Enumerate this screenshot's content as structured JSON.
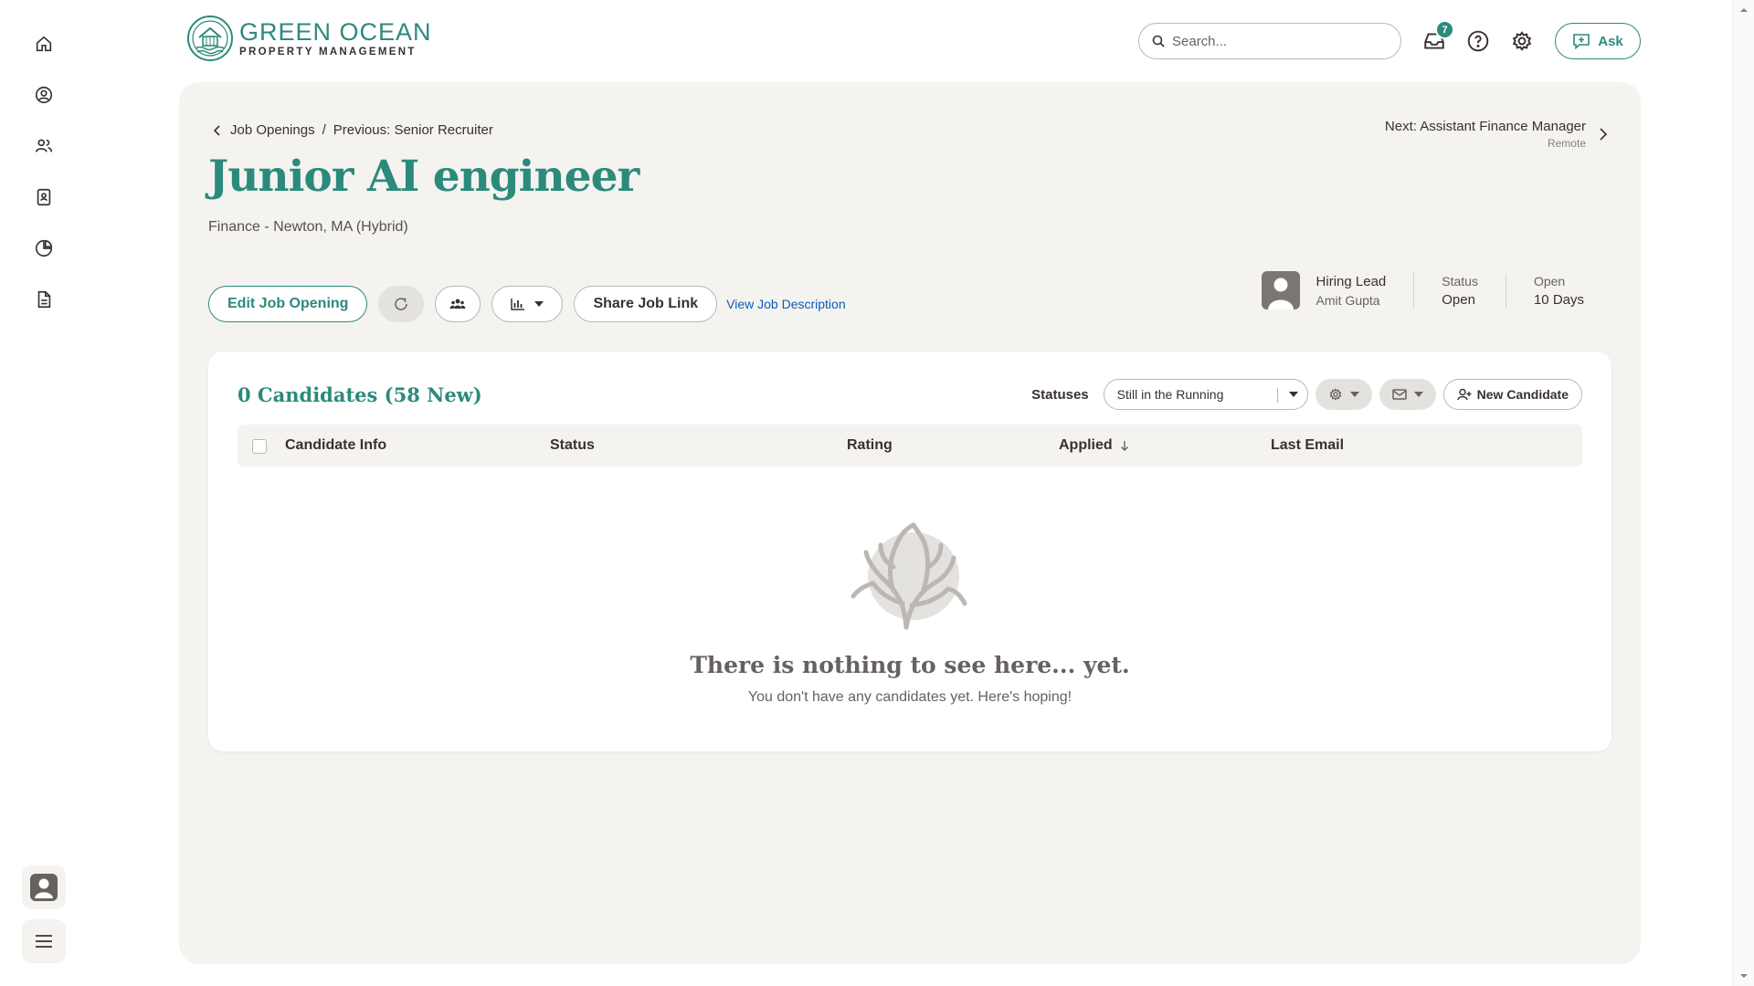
{
  "brand": {
    "line1": "GREEN OCEAN",
    "line2": "PROPERTY MANAGEMENT",
    "accent": "#2c8a7c"
  },
  "sidebar": {
    "items": [
      {
        "name": "home-icon"
      },
      {
        "name": "profile-icon"
      },
      {
        "name": "people-icon"
      },
      {
        "name": "directory-icon"
      },
      {
        "name": "reports-icon"
      },
      {
        "name": "documents-icon"
      }
    ]
  },
  "header": {
    "search_placeholder": "Search...",
    "inbox_count": "7",
    "ask_label": "Ask"
  },
  "breadcrumb": {
    "parent": "Job Openings",
    "separator": "/",
    "previous": "Previous: Senior Recruiter",
    "next_title": "Next: Assistant Finance Manager",
    "next_sub": "Remote"
  },
  "job": {
    "title": "Junior AI engineer",
    "subtitle": "Finance - Newton, MA (Hybrid)"
  },
  "actions": {
    "edit_label": "Edit Job Opening",
    "share_label": "Share Job Link",
    "view_desc_label": "View Job Description"
  },
  "summary": {
    "lead_label": "Hiring Lead",
    "lead_name": "Amit Gupta",
    "status_label": "Status",
    "status_value": "Open",
    "open_label": "Open",
    "open_value": "10 Days"
  },
  "candidates": {
    "count_title": "0 Candidates (58 New)",
    "statuses_label": "Statuses",
    "status_filter": "Still in the Running",
    "new_candidate_label": "New Candidate",
    "columns": [
      "Candidate Info",
      "Status",
      "Rating",
      "Applied",
      "Last Email"
    ],
    "empty_title": "There is nothing to see here... yet.",
    "empty_sub": "You don't have any candidates yet. Here's hoping!"
  }
}
